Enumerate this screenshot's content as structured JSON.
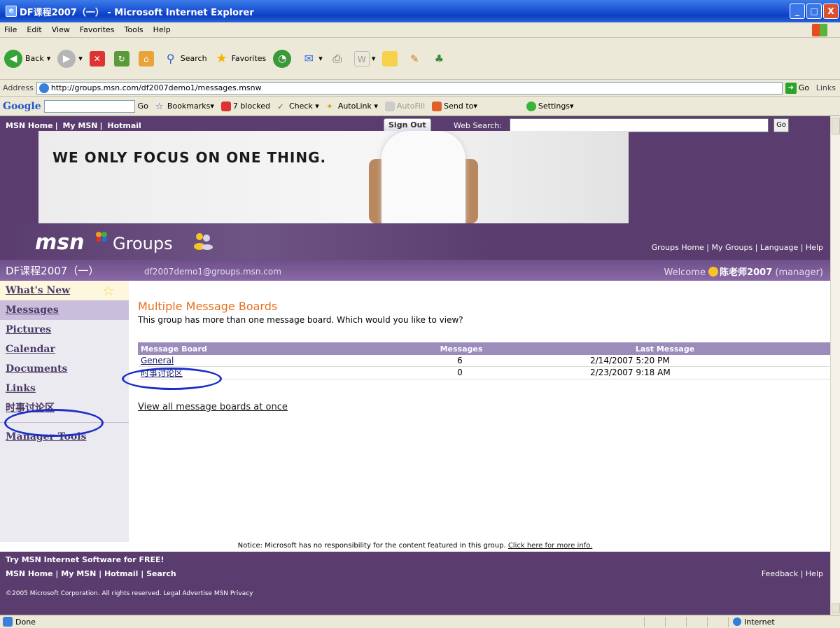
{
  "window": {
    "title": "DF课程2007（一） - Microsoft Internet Explorer",
    "controls": {
      "minimize": "_",
      "maximize": "□",
      "close": "X"
    }
  },
  "menu": [
    "File",
    "Edit",
    "View",
    "Favorites",
    "Tools",
    "Help"
  ],
  "toolbar": {
    "back": "Back",
    "search": "Search",
    "favorites": "Favorites"
  },
  "address": {
    "label": "Address",
    "url": "http://groups.msn.com/df2007demo1/messages.msnw",
    "go": "Go",
    "links": "Links"
  },
  "google": {
    "logo": "Google",
    "go": "Go",
    "bookmarks": "Bookmarks▾",
    "blocked": "7 blocked",
    "check": "Check ▾",
    "autolink": "AutoLink ▾",
    "autofill": "AutoFill",
    "sendto": "Send to▾",
    "settings": "Settings▾"
  },
  "msn": {
    "nav": [
      "MSN Home",
      "My MSN",
      "Hotmail"
    ],
    "signout": "Sign Out",
    "websearch_label": "Web Search:",
    "websearch_go": "Go",
    "banner_text": "WE ONLY FOCUS ON ONE THING.",
    "logo": "msn",
    "groups_word": "Groups",
    "groups_nav": "Groups Home | My Groups | Language | Help"
  },
  "group": {
    "name": "DF课程2007（一）",
    "email": "df2007demo1@groups.msn.com",
    "welcome_prefix": "Welcome",
    "user": "陈老师2007",
    "role": "(manager)"
  },
  "sidebar": {
    "items": [
      {
        "label": "What's New"
      },
      {
        "label": "Messages"
      },
      {
        "label": "Pictures"
      },
      {
        "label": "Calendar"
      },
      {
        "label": "Documents"
      },
      {
        "label": "Links"
      },
      {
        "label": "时事讨论区"
      },
      {
        "label": "Manager Tools"
      }
    ]
  },
  "content": {
    "title": "Multiple Message Boards",
    "subtitle": "This group has more than one message board. Which would you like to view?",
    "table": {
      "headers": [
        "Message Board",
        "Messages",
        "Last Message"
      ],
      "rows": [
        [
          "General",
          "6",
          "2/14/2007 5:20 PM"
        ],
        [
          "时事讨论区",
          "0",
          "2/23/2007 9:18 AM"
        ]
      ]
    },
    "view_all": "View all message boards at once"
  },
  "notice": {
    "text": "Notice: Microsoft has no responsibility for the content featured in this group.",
    "link": "Click here for more info."
  },
  "footer": {
    "try": "Try MSN Internet Software for FREE!",
    "nav": "MSN Home | My MSN | Hotmail | Search",
    "right": "Feedback | Help",
    "copyright": "©2005 Microsoft Corporation. All rights reserved.  Legal  Advertise  MSN Privacy"
  },
  "status": {
    "text": "Done",
    "zone": "Internet"
  },
  "colors": {
    "msn_purple": "#5a3d6e",
    "title_orange": "#e56e1c",
    "annotation_blue": "#1d2fc9"
  }
}
